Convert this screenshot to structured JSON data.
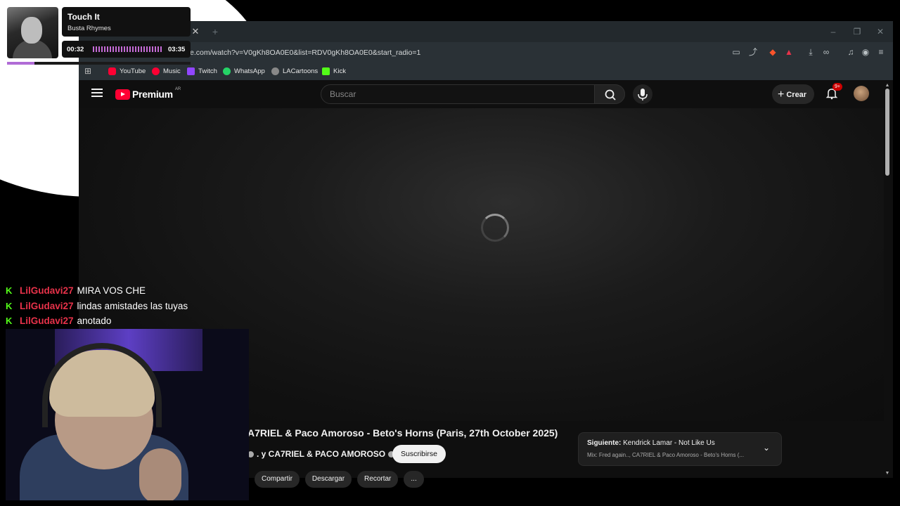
{
  "now_playing": {
    "title": "Touch It",
    "artist": "Busta Rhymes",
    "elapsed": "00:32",
    "duration": "03:35",
    "progress_fraction": 0.15
  },
  "browser": {
    "url": "e.com/watch?v=V0gKh8OA0E0&list=RDV0gKh8OA0E0&start_radio=1",
    "bookmarks": [
      {
        "label": "YouTube",
        "color": "#ff0033"
      },
      {
        "label": "Music",
        "color": "#ff0033"
      },
      {
        "label": "Twitch",
        "color": "#9146ff"
      },
      {
        "label": "WhatsApp",
        "color": "#25d366"
      },
      {
        "label": "LACartoons",
        "color": "#cccccc"
      },
      {
        "label": "Kick",
        "color": "#53fc18"
      }
    ]
  },
  "youtube": {
    "brand": "Premium",
    "country": "AR",
    "search_placeholder": "Buscar",
    "create_label": "Crear",
    "notifications_badge": "9+",
    "video_title": "A7RIEL & Paco Amoroso - Beto's Horns (Paris, 27th October 2025)",
    "channel": ". y CA7RIEL & PACO AMOROSO",
    "subscribe_label": "Suscribirse",
    "actions": [
      "Compartir",
      "Descargar",
      "Recortar",
      "..."
    ],
    "next_label": "Siguiente:",
    "next_title": "Kendrick Lamar - Not Like Us",
    "next_mix": "Mix: Fred again.., CA7RIEL & Paco Amoroso - Beto's Horns (..."
  },
  "chat": [
    {
      "user": "LilGudavi27",
      "message": "MIRA VOS CHE"
    },
    {
      "user": "LilGudavi27",
      "message": "lindas amistades las tuyas"
    },
    {
      "user": "LilGudavi27",
      "message": "anotado"
    }
  ],
  "colors": {
    "youtube_red": "#ff0033",
    "kick_green": "#53fc18",
    "chat_user": "#e8324a",
    "progress_purple": "#b06bd6"
  }
}
